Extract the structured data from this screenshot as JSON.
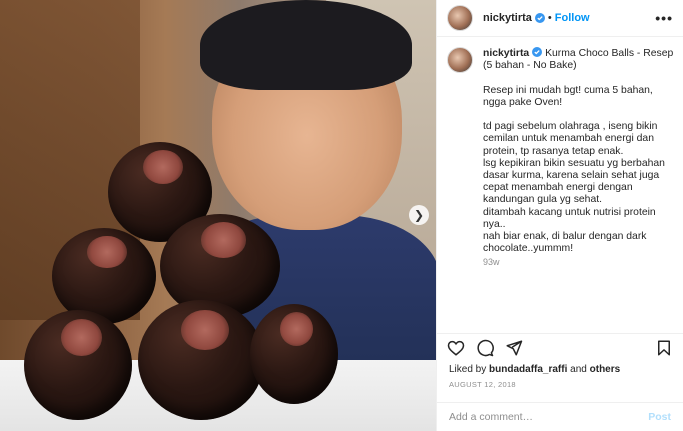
{
  "header": {
    "username": "nickytirta",
    "separator": "•",
    "follow_label": "Follow",
    "more_label": "•••"
  },
  "caption": {
    "username": "nickytirta",
    "text": " Kurma Choco Balls - Resep\n(5 bahan - No Bake)\n\nResep ini mudah bgt! cuma 5 bahan, ngga pake Oven!\n\ntd pagi sebelum olahraga , iseng bikin cemilan untuk menambah energi dan protein, tp rasanya tetap enak.\nlsg kepikiran bikin sesuatu yg berbahan dasar kurma, karena selain sehat juga cepat menambah energi dengan kandungan gula yg sehat.\nditambah kacang untuk nutrisi protein nya..\nnah biar enak, di balur dengan dark chocolate..yummm!",
    "time_ago": "93w"
  },
  "likes": {
    "prefix": "Liked by ",
    "user": "bundadaffa_raffi",
    "suffix": " and ",
    "others": "others"
  },
  "date": "AUGUST 12, 2018",
  "comment": {
    "placeholder": "Add a comment…",
    "post_label": "Post"
  },
  "icons": {
    "verified": "verified-badge-icon",
    "like": "heart-icon",
    "comment": "comment-bubble-icon",
    "share": "paper-plane-icon",
    "save": "bookmark-icon",
    "next": "chevron-right-icon"
  },
  "colors": {
    "accent": "#0095f6",
    "post_disabled": "#b2dffc",
    "muted": "#8e8e8e",
    "text": "#262626"
  }
}
